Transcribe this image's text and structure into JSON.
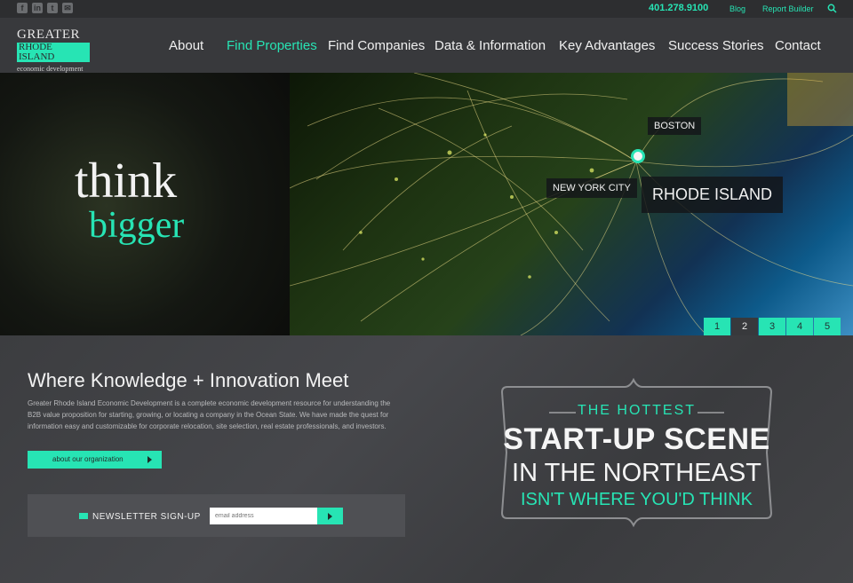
{
  "utility": {
    "social": [
      "f",
      "in",
      "t",
      "✉"
    ],
    "phone": "401.278.9100",
    "blog": "Blog",
    "report_builder": "Report Builder"
  },
  "logo": {
    "line1": "GREATER",
    "line2": "RHODE ISLAND",
    "line3": "economic development"
  },
  "nav": [
    "About",
    "Find Properties",
    "Find Companies",
    "Data & Information",
    "Key Advantages",
    "Success Stories",
    "Contact"
  ],
  "nav_active": "Find Properties",
  "hero": {
    "word1": "think",
    "word2": "bigger",
    "boston": "BOSTON",
    "nyc": "NEW YORK CITY",
    "rhode_island": "RHODE ISLAND",
    "slides": [
      "1",
      "2",
      "3",
      "4",
      "5"
    ],
    "current_slide": "2"
  },
  "main": {
    "heading": "Where Knowledge + Innovation Meet",
    "description": "Greater Rhode Island Economic Development is a complete economic development resource for understanding the B2B value proposition for starting, growing, or locating a company in the Ocean State. We have made the quest for information easy and customizable for corporate relocation, site selection, real estate professionals, and investors.",
    "about_button": "about our organization"
  },
  "newsletter": {
    "label": "NEWSLETTER SIGN-UP",
    "placeholder": "email address"
  },
  "promo": {
    "line1": "THE HOTTEST",
    "line2": "START-UP SCENE",
    "line3": "IN THE NORTHEAST",
    "line4": "ISN'T WHERE YOU'D THINK"
  },
  "colors": {
    "accent": "#27e4b4",
    "background": "#3a3b3e",
    "header": "#38393c"
  }
}
